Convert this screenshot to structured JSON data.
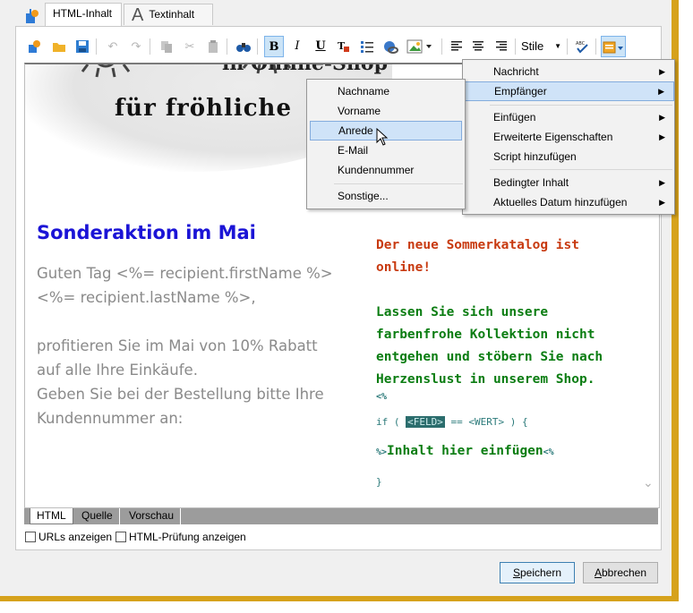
{
  "tabs": [
    {
      "label": "HTML-Inhalt",
      "icon": "html-content-icon",
      "active": true
    },
    {
      "label": "Textinhalt",
      "icon": "text-content-icon",
      "active": false
    }
  ],
  "toolbar": {
    "styles_label": "Stile",
    "bold": "B",
    "italic": "I",
    "underline": "U"
  },
  "content": {
    "banner_top": "in Online-Shop",
    "banner_text": "für fröhliche",
    "headline": "Sonderaktion im Mai",
    "body": [
      "Guten Tag  <%= recipient.firstName %>",
      "<%= recipient.lastName %>,",
      "",
      "profitieren Sie im Mai von 10% Rabatt",
      "auf alle Ihre Einkäufe.",
      "Geben Sie bei der Bestellung bitte Ihre",
      "Kundennummer an:"
    ],
    "right_red": [
      "Der neue Sommerkatalog ist",
      "online!"
    ],
    "right_green": [
      "Lassen Sie sich unsere",
      "farbenfrohe Kollektion nicht",
      "entgehen und stöbern Sie nach",
      "Herzenslust in unserem Shop."
    ],
    "code_open": "<%",
    "code_if_prefix": "if ( ",
    "code_feld": "<FELD>",
    "code_if_mid": " == ",
    "code_wert": "<WERT>",
    "code_if_suffix": " ) {",
    "insert_open": "%>",
    "insert_text": "Inhalt hier einfügen",
    "insert_close": "<%",
    "code_close": "}"
  },
  "editor_tabs": [
    "HTML",
    "Quelle",
    "Vorschau"
  ],
  "checkboxes": [
    {
      "label": "URLs anzeigen",
      "checked": false
    },
    {
      "label": "HTML-Prüfung anzeigen",
      "checked": false
    }
  ],
  "buttons": {
    "save": "Speichern",
    "cancel": "Abbrechen"
  },
  "main_menu": [
    {
      "label": "Nachricht",
      "submenu": true
    },
    {
      "label": "Empfänger",
      "submenu": true,
      "highlighted": true
    },
    {
      "label": "Einfügen",
      "submenu": true
    },
    {
      "label": "Erweiterte Eigenschaften",
      "submenu": true
    },
    {
      "label": "Script hinzufügen",
      "submenu": false
    },
    {
      "label": "Bedingter Inhalt",
      "submenu": true
    },
    {
      "label": "Aktuelles Datum hinzufügen",
      "submenu": true
    }
  ],
  "sub_menu": [
    {
      "label": "Nachname"
    },
    {
      "label": "Vorname"
    },
    {
      "label": "Anrede",
      "highlighted": true
    },
    {
      "label": "E-Mail"
    },
    {
      "label": "Kundennummer"
    },
    {
      "label": "Sonstige..."
    }
  ],
  "colors": {
    "headline": "#1b14d6",
    "red_text": "#c83a10",
    "green_text": "#0b7d12",
    "menu_highlight": "#cfe3f8",
    "window_border": "#d6a21c"
  }
}
